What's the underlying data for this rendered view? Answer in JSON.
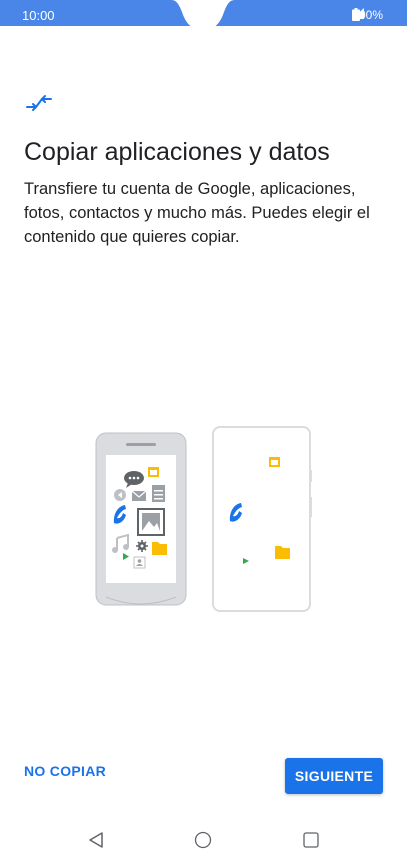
{
  "status_bar": {
    "time": "10:00",
    "battery": "100%",
    "bg_color": "#4a86e8"
  },
  "header": {
    "icon": "transfer-arrows-icon",
    "title": "Copiar aplicaciones y datos",
    "description": "Transfiere tu cuenta de Google, aplicaciones, fotos, contactos y mucho más. Puedes elegir el contenido que quieres copiar."
  },
  "illustration": {
    "icons": [
      "phone-old-icon",
      "phone-new-icon",
      "chat-icon",
      "calendar-icon",
      "mail-icon",
      "document-icon",
      "call-icon",
      "image-icon",
      "music-icon",
      "play-icon",
      "settings-icon",
      "folder-icon",
      "contact-icon"
    ]
  },
  "actions": {
    "skip_label": "NO COPIAR",
    "next_label": "SIGUIENTE",
    "accent_color": "#1a73e8"
  },
  "nav": {
    "back_icon": "back-triangle-icon",
    "home_icon": "home-circle-icon",
    "recents_icon": "recents-square-icon"
  }
}
